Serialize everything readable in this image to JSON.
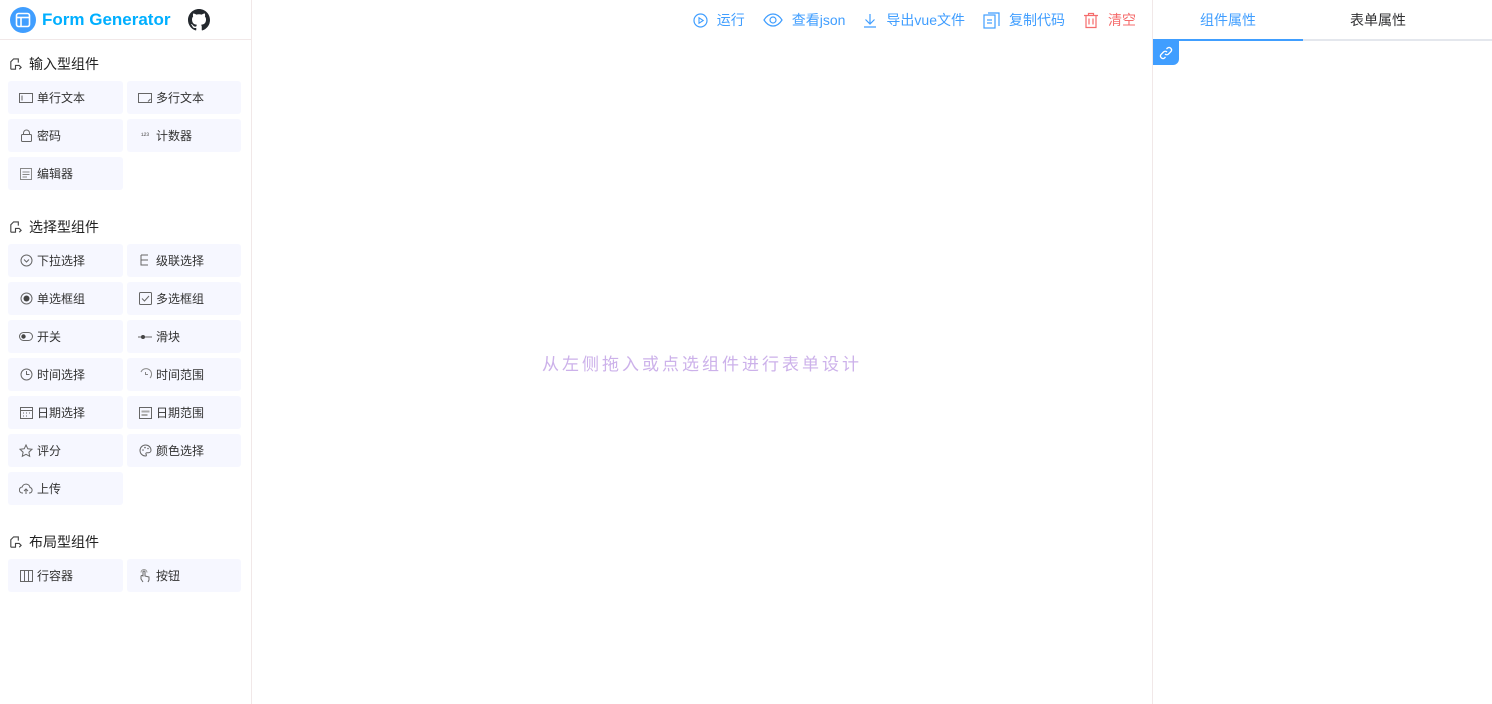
{
  "header": {
    "logo_text": "Form Generator"
  },
  "groups": [
    {
      "title": "输入型组件",
      "items": [
        {
          "label": "单行文本",
          "icon": "input-icon"
        },
        {
          "label": "多行文本",
          "icon": "textarea-icon"
        },
        {
          "label": "密码",
          "icon": "password-icon"
        },
        {
          "label": "计数器",
          "icon": "number-icon"
        },
        {
          "label": "编辑器",
          "icon": "editor-icon"
        }
      ]
    },
    {
      "title": "选择型组件",
      "items": [
        {
          "label": "下拉选择",
          "icon": "select-icon"
        },
        {
          "label": "级联选择",
          "icon": "cascader-icon"
        },
        {
          "label": "单选框组",
          "icon": "radio-icon"
        },
        {
          "label": "多选框组",
          "icon": "checkbox-icon"
        },
        {
          "label": "开关",
          "icon": "switch-icon"
        },
        {
          "label": "滑块",
          "icon": "slider-icon"
        },
        {
          "label": "时间选择",
          "icon": "time-icon"
        },
        {
          "label": "时间范围",
          "icon": "time-range-icon"
        },
        {
          "label": "日期选择",
          "icon": "date-icon"
        },
        {
          "label": "日期范围",
          "icon": "date-range-icon"
        },
        {
          "label": "评分",
          "icon": "rate-icon"
        },
        {
          "label": "颜色选择",
          "icon": "color-icon"
        },
        {
          "label": "上传",
          "icon": "upload-icon"
        }
      ]
    },
    {
      "title": "布局型组件",
      "items": [
        {
          "label": "行容器",
          "icon": "row-icon"
        },
        {
          "label": "按钮",
          "icon": "button-icon"
        }
      ]
    }
  ],
  "actions": {
    "run": "运行",
    "view_json": "查看json",
    "export_vue": "导出vue文件",
    "copy_code": "复制代码",
    "clear": "清空"
  },
  "canvas": {
    "empty_text": "从左侧拖入或点选组件进行表单设计"
  },
  "right_panel": {
    "tabs": [
      "组件属性",
      "表单属性"
    ]
  },
  "colors": {
    "primary": "#409eff",
    "danger": "#f56c6c",
    "empty_text": "#ccb1ea",
    "item_bg": "#f6f7ff"
  }
}
